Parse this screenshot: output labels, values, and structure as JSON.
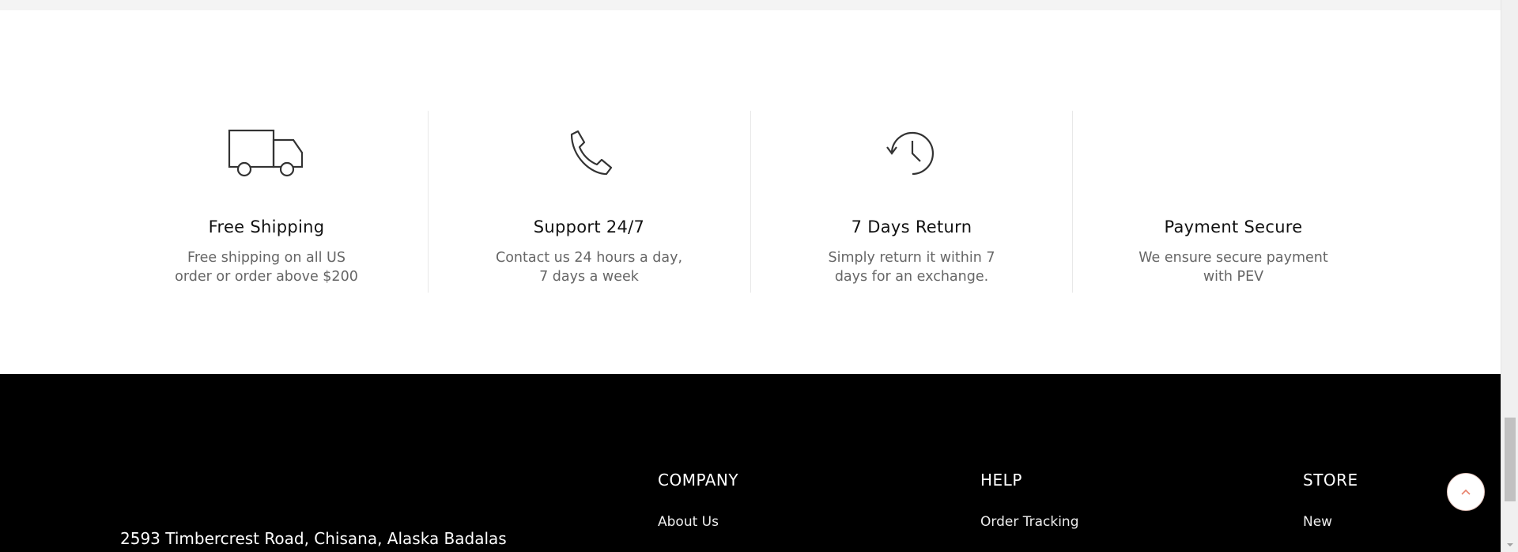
{
  "features": [
    {
      "icon": "truck-icon",
      "title": "Free Shipping",
      "description": "Free shipping on all US order or order above $200"
    },
    {
      "icon": "phone-icon",
      "title": "Support 24/7",
      "description": "Contact us 24 hours a day, 7 days a week"
    },
    {
      "icon": "history-icon",
      "title": "7 Days Return",
      "description": "Simply return it within 7 days for an exchange."
    },
    {
      "icon": "",
      "title": "Payment Secure",
      "description": "We ensure secure payment with PEV"
    }
  ],
  "footer": {
    "address": "2593 Timbercrest Road, Chisana, Alaska Badalas",
    "columns": [
      {
        "heading": "COMPANY",
        "first_link": "About Us"
      },
      {
        "heading": "HELP",
        "first_link": "Order Tracking"
      },
      {
        "heading": "STORE",
        "first_link": "New"
      }
    ]
  },
  "back_to_top_icon": "chevron-up-icon",
  "colors": {
    "accent": "#e8806a",
    "footer_bg": "#000000",
    "text_muted": "#666666"
  }
}
